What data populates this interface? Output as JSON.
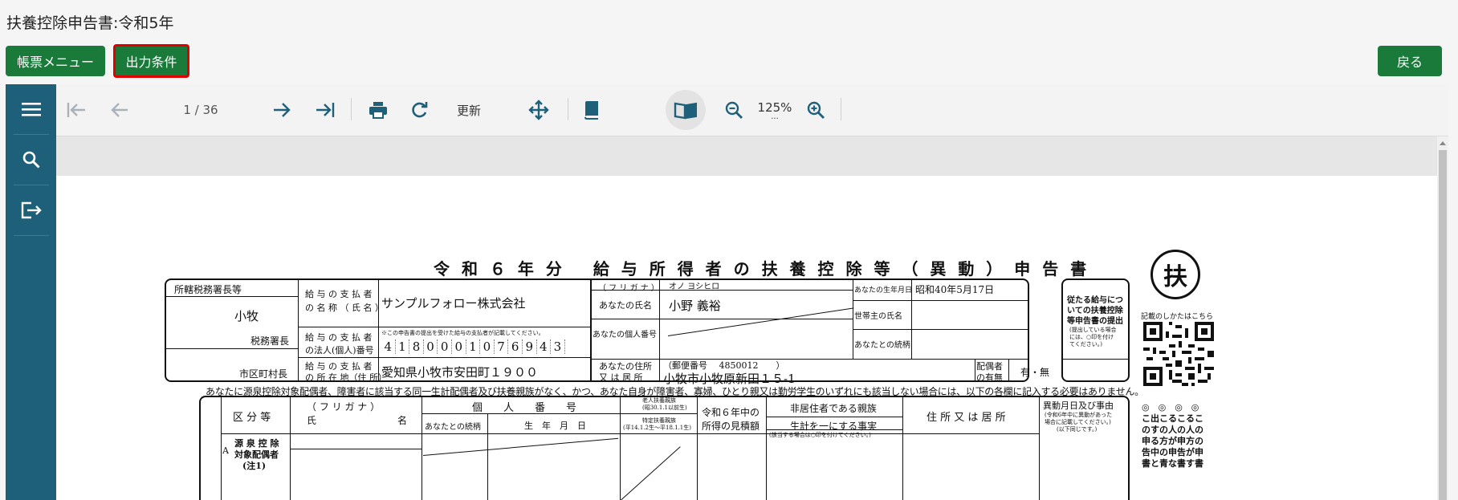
{
  "page": {
    "title": "扶養控除申告書:令和5年"
  },
  "actions": {
    "menu_label": "帳票メニュー",
    "condition_label": "出力条件",
    "back_label": "戻る"
  },
  "sidebar": {
    "items": [
      {
        "icon": "hamburger-icon"
      },
      {
        "icon": "search-icon"
      },
      {
        "icon": "exit-icon"
      }
    ]
  },
  "toolbar": {
    "page_indicator": "1 / 36",
    "refresh_label": "更新",
    "zoom": "125%",
    "zoom_extra": "...",
    "icons": [
      "first-page-icon",
      "prev-page-icon",
      "next-page-icon",
      "last-page-icon",
      "print-icon",
      "rotate-icon",
      "move-icon",
      "single-page-icon",
      "book-view-icon",
      "zoom-out-icon",
      "zoom-in-icon"
    ]
  },
  "document": {
    "title": "令 和 ６ 年 分　 給 与 所 得 者 の 扶 養 控 除 等 （ 異 動 ） 申 告 書",
    "fu_mark": "扶",
    "qr_caption": "記載のしかたはこちら",
    "tax_office_label": "所轄税務署長等",
    "tax_office": "小牧",
    "tax_office_suffix": "税務署長",
    "city_suffix": "市区町村長",
    "payer_name_label1": "給 与 の 支 払 者",
    "payer_name_label2": "の 名 称 （ 氏 名 ）",
    "payer_name": "サンプルフォロー株式会社",
    "payer_number_label1": "給 与 の 支 払 者",
    "payer_number_label2": "の法人(個人)番号",
    "payer_number_note": "※この申告書の提出を受けた給与の支払者が記載してください。",
    "payer_number_digits": [
      "4",
      "1",
      "8",
      "0",
      "0",
      "0",
      "1",
      "0",
      "7",
      "6",
      "9",
      "4",
      "3"
    ],
    "payer_address_label1": "給 与 の 支 払 者",
    "payer_address_label2": "の 所 在 地（住 所）",
    "payer_address": "愛知県小牧市安田町１９００",
    "furigana_label": "（ フ リ ガ ナ ）",
    "furigana": "オノ ヨシヒロ",
    "name_label": "あなたの氏名",
    "name": "小野 義裕",
    "my_number_label": "あなたの個人番号",
    "address_label1": "あなたの住所",
    "address_label2": "又 は 居 所",
    "postal": "（郵便番号　 4850012　　）",
    "address": "小牧市小牧原新田１５-1",
    "birth_label": "あなたの生年月日",
    "birth": "昭和40年5月17日",
    "householder_label": "世帯主の氏名",
    "relation_label": "あなたとの続柄",
    "spouse_label1": "配偶者",
    "spouse_label2": "の有無",
    "spouse_value": "有・無",
    "side_note_title": [
      "従たる給与につ",
      "いての扶養控除",
      "等申告書の提出"
    ],
    "side_note_small": [
      "(提出している場合",
      "には、○印を付け",
      "てください。)"
    ],
    "notice": "あなたに源泉控除対象配偶者、障害者に該当する同一生計配偶者及び扶養親族がなく、かつ、あなた自身が障害者、寡婦、ひとり親又は勤労学生のいずれにも該当しない場合には、以下の各欄に記入する必要はありません。",
    "col_kubun": "区 分 等",
    "col_furigana": "（ フ リ ガ ナ ）",
    "col_name1": "氏",
    "col_name2": "名",
    "col_kojin": "個　　人　　番　　号",
    "col_relation": "あなたとの続柄",
    "col_birth": "生　年　月　日",
    "col_elder1": "老人扶養親族",
    "col_elder2": "(昭30.1.1以前生)",
    "col_special1": "特定扶養親族",
    "col_special2": "(平14.1.2生～平18.1.1生)",
    "col_income1": "令和６年中の",
    "col_income2": "所得の見積額",
    "col_nonres": "非居住者である親族",
    "col_livelihood": "生計を一にする事実",
    "col_livelihood_note": "(該当する場合は○印を付けてください。)",
    "col_address": "住 所 又 は 居 所",
    "col_change1": "異動月日及び事由",
    "col_change2": "(令和6年中に異動があった",
    "col_change3": "場合に記載してください。)",
    "col_change4": "(以下同じです。)",
    "row_a_mark": "A",
    "row_a_label1": "源 泉 控 除",
    "row_a_label2": "対象配偶者",
    "row_a_label3": "(注1)",
    "right_vertical": [
      "◎　◎　◎　◎",
      "こ出こるこるこ",
      "のすの人の人の",
      "申る方が申方の",
      "告中の申告が申",
      "書と青な書す書"
    ]
  }
}
